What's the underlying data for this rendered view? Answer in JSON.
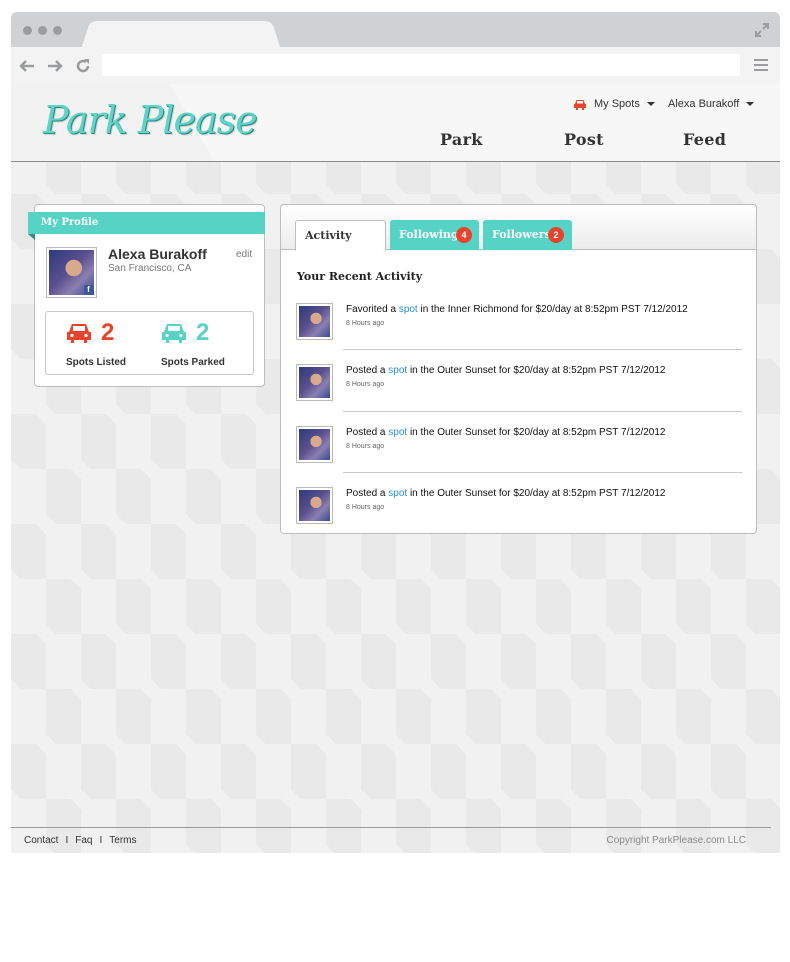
{
  "browser": {
    "expand_icon": "expand-icon",
    "back_icon": "back-arrow-icon",
    "forward_icon": "forward-arrow-icon",
    "reload_icon": "reload-icon",
    "menu_icon": "hamburger-menu-icon"
  },
  "header": {
    "logo": "Park Please",
    "my_spots": "My Spots",
    "user_name": "Alexa Burakoff",
    "nav": [
      "Park",
      "Post",
      "Feed"
    ]
  },
  "profile": {
    "section_title": "My Profile",
    "name": "Alexa Burakoff",
    "location": "San Francisco, CA",
    "edit_label": "edit",
    "spots_listed": "2",
    "spots_listed_label": "Spots Listed",
    "spots_parked": "2",
    "spots_parked_label": "Spots Parked"
  },
  "tabs": {
    "activity": "Activity",
    "following": "Following",
    "following_count": "4",
    "followers": "Followers",
    "followers_count": "2"
  },
  "activity": {
    "title": "Your Recent Activity",
    "items": [
      {
        "prefix": "Favorited a",
        "link": "spot",
        "suffix": "in the Inner Richmond for $20/day at 8:52pm PST 7/12/2012",
        "time": "8 Hours ago"
      },
      {
        "prefix": "Posted a",
        "link": "spot",
        "suffix": "in the Outer Sunset for $20/day at 8:52pm PST 7/12/2012",
        "time": "8 Hours ago"
      },
      {
        "prefix": "Posted a",
        "link": "spot",
        "suffix": "in the Outer Sunset for $20/day at 8:52pm PST 7/12/2012",
        "time": "8 Hours ago"
      },
      {
        "prefix": "Posted a",
        "link": "spot",
        "suffix": "in the Outer Sunset for $20/day at 8:52pm PST 7/12/2012",
        "time": "8 Hours ago"
      }
    ]
  },
  "footer": {
    "links": [
      "Contact",
      "Faq",
      "Terms"
    ],
    "separator": "I",
    "copyright": "Copyright ParkPlease.com LLC"
  },
  "colors": {
    "teal": "#56d3c5",
    "red": "#e8432c",
    "link_blue": "#2a8fd6"
  }
}
